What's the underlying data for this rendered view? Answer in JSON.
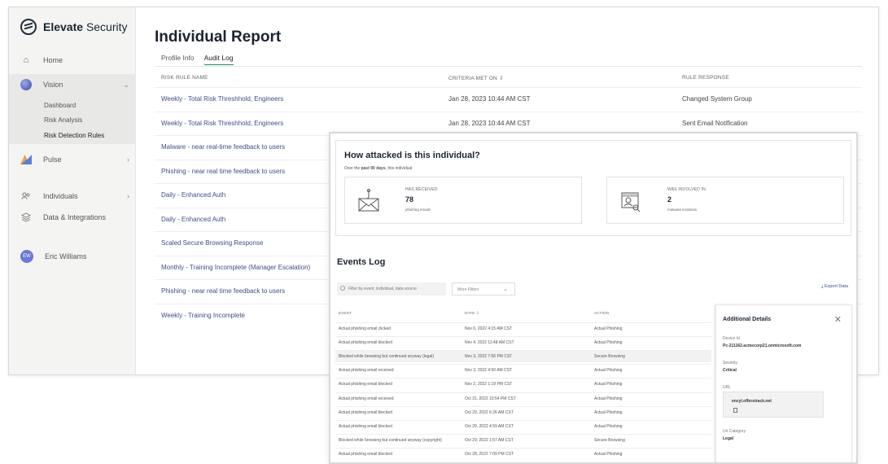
{
  "app": {
    "brand": "Elevate",
    "brand_suffix": "Security"
  },
  "sidebar": {
    "home": "Home",
    "vision": "Vision",
    "vision_sub": [
      "Dashboard",
      "Risk Analysis",
      "Risk Detection Rules"
    ],
    "pulse": "Pulse",
    "individuals": "Individuals",
    "data": "Data & Integrations",
    "user_initials": "EW",
    "user_name": "Eric Williams"
  },
  "page": {
    "title": "Individual Report",
    "tabs": [
      "Profile Info",
      "Audit Log"
    ],
    "active_tab": "Audit Log"
  },
  "audit_table": {
    "columns": [
      "RISK RULE NAME",
      "CRITERIA MET ON ⇩",
      "RULE RESPONSE"
    ],
    "rows": [
      {
        "rule": "Weekly - Total Risk Threshhold, Engineers",
        "date": "Jan 28, 2023 10:44 AM CST",
        "response": "Changed System Group"
      },
      {
        "rule": "Weekly - Total Risk Threshhold, Engineers",
        "date": "Jan 28, 2023 10:44 AM CST",
        "response": "Sent Email Notification"
      },
      {
        "rule": "Malware - near real-time feedback to users",
        "date": "",
        "response": ""
      },
      {
        "rule": "Phishing - near real time feedback to users",
        "date": "",
        "response": ""
      },
      {
        "rule": "Daily - Enhanced Auth",
        "date": "",
        "response": ""
      },
      {
        "rule": "Daily - Enhanced Auth",
        "date": "",
        "response": ""
      },
      {
        "rule": "Scaled Secure Browsing Response",
        "date": "",
        "response": ""
      },
      {
        "rule": "Monthly - Training Incomplete (Manager Escalation)",
        "date": "",
        "response": ""
      },
      {
        "rule": "Phishing - near real time feedback to users",
        "date": "",
        "response": ""
      },
      {
        "rule": "Weekly - Training Incomplete",
        "date": "",
        "response": ""
      }
    ]
  },
  "attack": {
    "title": "How attacked is this individual?",
    "sub_prefix": "Over the ",
    "sub_bold": "past 90 days",
    "sub_suffix": ", this individual",
    "received_label": "HAS RECEIVED",
    "received_value": "78",
    "received_unit": "phishing emails",
    "involved_label": "WAS INVOLVED IN",
    "involved_value": "2",
    "involved_unit": "malware incidents"
  },
  "events": {
    "title": "Events Log",
    "filter_placeholder": "Filter by event, individual, data source",
    "more_filters": "More Filters",
    "export": "Export Data",
    "columns": [
      "EVENT",
      "DATE ⇩",
      "ACTION"
    ],
    "rows": [
      {
        "event": "Actual phishing email clicked",
        "date": "Nov 6, 2022 4:15 AM CST",
        "action": "Actual Phishing"
      },
      {
        "event": "Actual phishing email blocked",
        "date": "Nov 4, 2022 11:48 AM CST",
        "action": "Actual Phishing"
      },
      {
        "event": "Blocked while browsing but continued anyway (legal)",
        "date": "Nov 3, 2022 7:56 PM CST",
        "action": "Secure Browsing"
      },
      {
        "event": "Actual phishing email received",
        "date": "Nov 3, 2022 4:50 AM CST",
        "action": "Actual Phishing"
      },
      {
        "event": "Actual phishing email blocked",
        "date": "Nov 2, 2022 1:19 PM CST",
        "action": "Actual Phishing"
      },
      {
        "event": "Actual phishing email received",
        "date": "Oct 31, 2022 10:54 PM CST",
        "action": "Actual Phishing"
      },
      {
        "event": "Actual phishing email blocked",
        "date": "Oct 29, 2022 6:26 AM CST",
        "action": "Actual Phishing"
      },
      {
        "event": "Actual phishing email blocked",
        "date": "Oct 29, 2022 4:59 AM CST",
        "action": "Actual Phishing"
      },
      {
        "event": "Blocked while browsing but continued anyway (copyright)",
        "date": "Oct 29, 2022 1:57 AM CST",
        "action": "Secure Browsing"
      },
      {
        "event": "Actual phishing email blocked",
        "date": "Oct 28, 2022 7:09 PM CST",
        "action": "Actual Phishing"
      }
    ]
  },
  "details": {
    "title": "Additional Details",
    "device_label": "Device Id",
    "device_value": "Pc-211162.acmecorp21.onmicrosoft.com",
    "severity_label": "Severity",
    "severity_value": "Critical",
    "url_label": "URL",
    "url_value": "encyl.offerstrack.net",
    "category_label": "Url Category",
    "category_value": "Legal"
  },
  "colors": {
    "accent_link": "#3c4f8a",
    "tab_underline": "#1b8f73",
    "sidebar_bg": "#f4f4f2"
  }
}
